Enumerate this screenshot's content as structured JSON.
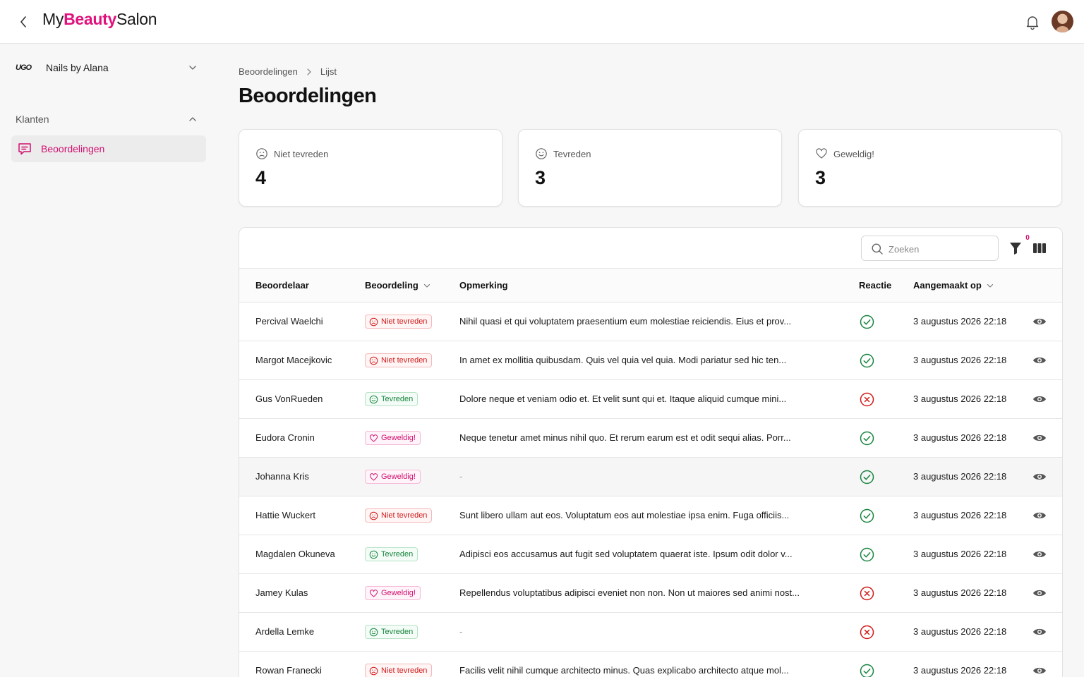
{
  "header": {
    "logo": {
      "my": "My",
      "beauty": "Beauty",
      "salon": "Salon"
    },
    "icons": {
      "back": "chevron-left-icon",
      "notifications": "bell-icon",
      "avatar": "user-avatar"
    },
    "brand_color": "#e0117c"
  },
  "sidebar": {
    "salon": {
      "logo_text": "UGO",
      "name": "Nails by Alana"
    },
    "section": {
      "label": "Klanten"
    },
    "items": [
      {
        "label": "Beoordelingen",
        "icon": "chat-bubble-icon",
        "active": true
      }
    ]
  },
  "breadcrumb": {
    "items": [
      "Beoordelingen",
      "Lijst"
    ]
  },
  "page": {
    "title": "Beoordelingen"
  },
  "stats": [
    {
      "label": "Niet tevreden",
      "value": "4",
      "icon": "frown-face-icon"
    },
    {
      "label": "Tevreden",
      "value": "3",
      "icon": "smile-face-icon"
    },
    {
      "label": "Geweldig!",
      "value": "3",
      "icon": "heart-icon"
    }
  ],
  "toolbar": {
    "search_placeholder": "Zoeken",
    "filter_count": "0"
  },
  "table": {
    "columns": {
      "reviewer": "Beoordelaar",
      "rating": "Beoordeling",
      "comment": "Opmerking",
      "reaction": "Reactie",
      "created": "Aangemaakt op"
    },
    "rows": [
      {
        "reviewer": "Percival Waelchi",
        "rating": "Niet tevreden",
        "rating_type": "neg",
        "comment": "Nihil quasi et qui voluptatem praesentium eum molestiae reiciendis. Eius et prov...",
        "reacted": true,
        "created": "3 augustus 2026 22:18"
      },
      {
        "reviewer": "Margot Macejkovic",
        "rating": "Niet tevreden",
        "rating_type": "neg",
        "comment": "In amet ex mollitia quibusdam. Quis vel quia vel quia. Modi pariatur sed hic ten...",
        "reacted": true,
        "created": "3 augustus 2026 22:18"
      },
      {
        "reviewer": "Gus VonRueden",
        "rating": "Tevreden",
        "rating_type": "pos",
        "comment": "Dolore neque et veniam odio et. Et velit sunt qui et. Itaque aliquid cumque mini...",
        "reacted": false,
        "created": "3 augustus 2026 22:18"
      },
      {
        "reviewer": "Eudora Cronin",
        "rating": "Geweldig!",
        "rating_type": "love",
        "comment": "Neque tenetur amet minus nihil quo. Et rerum earum est et odit sequi alias. Porr...",
        "reacted": true,
        "created": "3 augustus 2026 22:18"
      },
      {
        "reviewer": "Johanna Kris",
        "rating": "Geweldig!",
        "rating_type": "love",
        "comment": "-",
        "reacted": true,
        "created": "3 augustus 2026 22:18"
      },
      {
        "reviewer": "Hattie Wuckert",
        "rating": "Niet tevreden",
        "rating_type": "neg",
        "comment": "Sunt libero ullam aut eos. Voluptatum eos aut molestiae ipsa enim. Fuga officiis...",
        "reacted": true,
        "created": "3 augustus 2026 22:18"
      },
      {
        "reviewer": "Magdalen Okuneva",
        "rating": "Tevreden",
        "rating_type": "pos",
        "comment": "Adipisci eos accusamus aut fugit sed voluptatem quaerat iste. Ipsum odit dolor v...",
        "reacted": true,
        "created": "3 augustus 2026 22:18"
      },
      {
        "reviewer": "Jamey Kulas",
        "rating": "Geweldig!",
        "rating_type": "love",
        "comment": "Repellendus voluptatibus adipisci eveniet non non. Non ut maiores sed animi nost...",
        "reacted": false,
        "created": "3 augustus 2026 22:18"
      },
      {
        "reviewer": "Ardella Lemke",
        "rating": "Tevreden",
        "rating_type": "pos",
        "comment": "-",
        "reacted": false,
        "created": "3 augustus 2026 22:18"
      },
      {
        "reviewer": "Rowan Franecki",
        "rating": "Niet tevreden",
        "rating_type": "neg",
        "comment": "Facilis velit nihil cumque architecto minus. Quas explicabo architecto atque mol...",
        "reacted": true,
        "created": "3 augustus 2026 22:18"
      }
    ]
  },
  "colors": {
    "negative": "#d11a1a",
    "positive": "#18853f",
    "love": "#d1106f"
  }
}
